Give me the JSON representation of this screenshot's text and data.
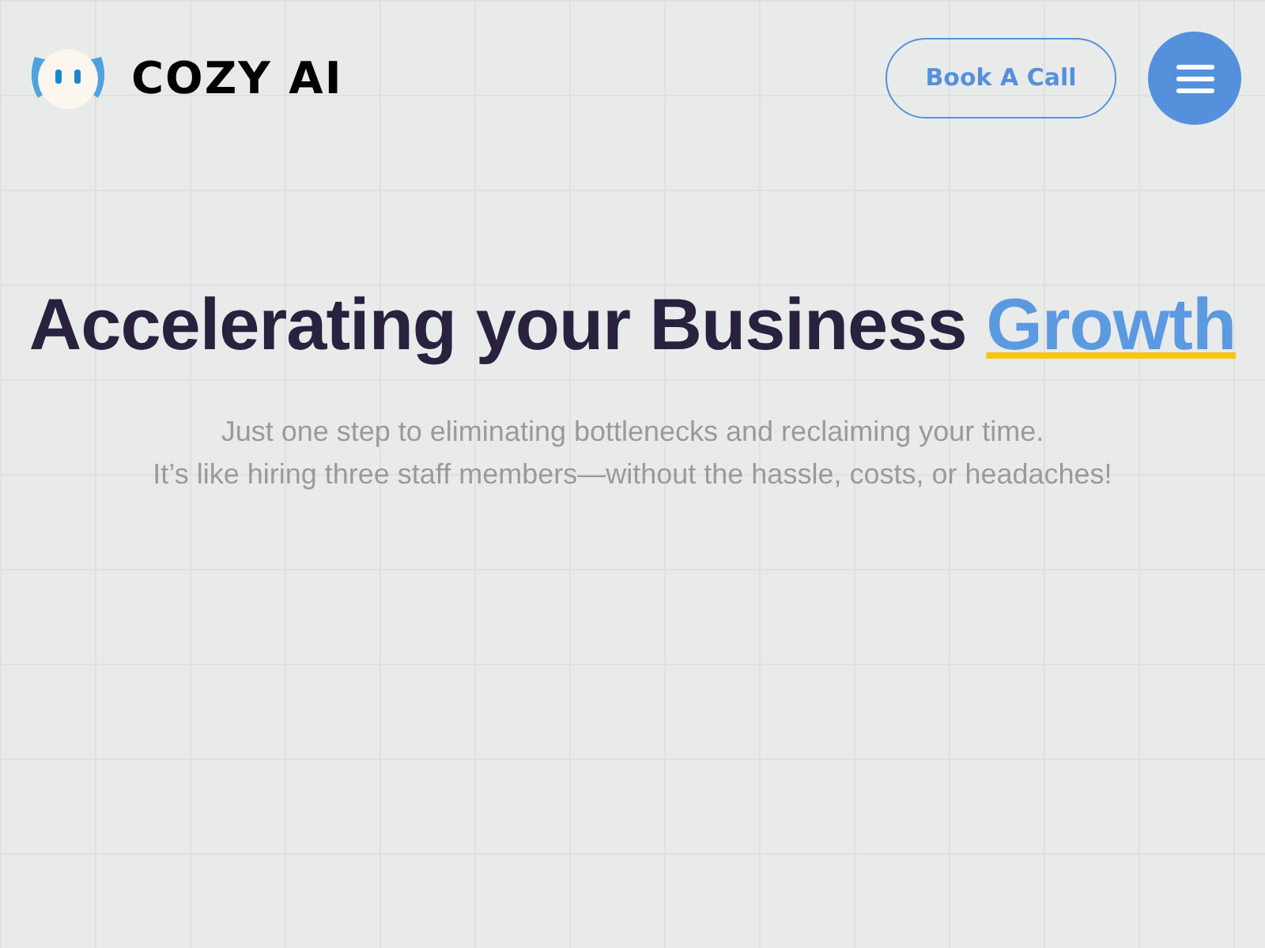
{
  "header": {
    "logo_text": "COZY AI",
    "cta": "Book A Call"
  },
  "hero": {
    "title": "Accelerating your Business",
    "highlight": "Growth",
    "subtitle_lines": [
      "Just one step to eliminating bottlenecks and reclaiming your time.",
      "It’s like hiring three staff members—without the hassle, costs, or headaches!"
    ]
  }
}
